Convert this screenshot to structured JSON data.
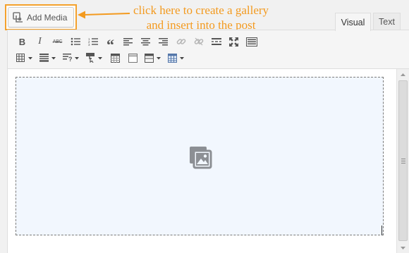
{
  "add_media": {
    "label": "Add Media"
  },
  "callout": {
    "line1": "click here to create a gallery",
    "line2": "and insert into the post"
  },
  "tabs": {
    "visual": "Visual",
    "text": "Text"
  },
  "toolbar": {
    "row1": [
      "bold-icon",
      "italic-icon",
      "strikethrough-icon",
      "bullet-list-icon",
      "numbered-list-icon",
      "blockquote-icon",
      "align-left-icon",
      "align-center-icon",
      "align-right-icon",
      "insert-link-icon",
      "remove-link-icon",
      "read-more-icon",
      "fullscreen-icon",
      "toolbar-toggle-icon"
    ],
    "row2": [
      "table-icon",
      "text-color-icon",
      "special-character-icon",
      "paste-format-icon",
      "calendar-icon",
      "page-icon",
      "columns-icon",
      "grid-icon"
    ]
  },
  "colors": {
    "callout": "#f39a1f",
    "highlight_border": "#f4a12c",
    "content_bg": "#f2f7fe"
  }
}
